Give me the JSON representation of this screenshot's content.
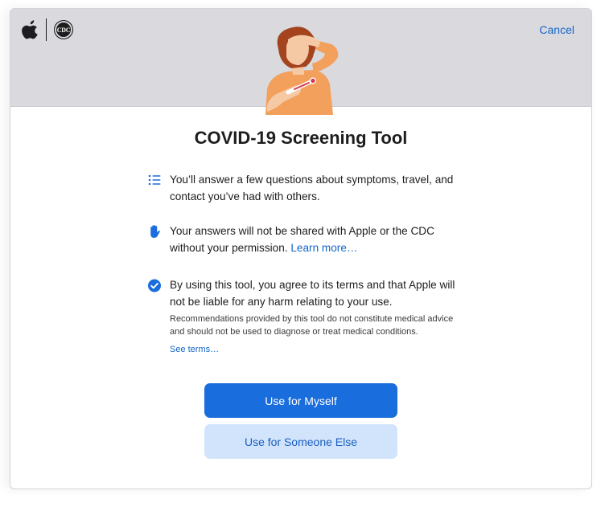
{
  "header": {
    "cdc_logo_text": "CDC",
    "cancel_label": "Cancel"
  },
  "title": "COVID-19 Screening Tool",
  "items": [
    {
      "icon": "list-icon",
      "text": "You’ll answer a few questions about symptoms, travel, and contact you’ve had with others."
    },
    {
      "icon": "hand-icon",
      "text": "Your answers will not be shared with Apple or the CDC without your permission.",
      "link": "Learn more…"
    },
    {
      "icon": "checkmark-circle-icon",
      "text": "By using this tool, you agree to its terms and that Apple will not be liable for any harm relating to your use.",
      "note": "Recommendations provided by this tool do not constitute medical advice and should not be used to diagnose or treat medical conditions.",
      "link": "See terms…"
    }
  ],
  "buttons": {
    "primary": "Use for Myself",
    "secondary": "Use for Someone Else"
  },
  "colors": {
    "accent": "#1a6ddc",
    "accent_light": "#d2e4fb",
    "header_bg": "#d9d9de",
    "illustration_skin": "#f2a05c",
    "illustration_hair": "#a3441f"
  }
}
